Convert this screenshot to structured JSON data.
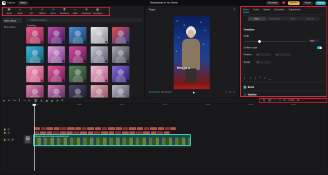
{
  "titlebar": {
    "app_name": "CapCut",
    "menu_label": "Menu",
    "project_title": "Mohammad in Ho Shrine",
    "shortcuts_label": "Shortcuts",
    "pro_label": "Join Pro",
    "share_label": "Share",
    "export_label": "Export"
  },
  "toolbar": {
    "tabs": [
      {
        "label": "Import",
        "icon": "import-icon"
      },
      {
        "label": "Audio",
        "icon": "audio-icon"
      },
      {
        "label": "Text",
        "icon": "text-icon"
      },
      {
        "label": "Stickers",
        "icon": "stickers-icon"
      },
      {
        "label": "Effects",
        "icon": "effects-icon"
      },
      {
        "label": "Transitions",
        "icon": "transitions-icon"
      },
      {
        "label": "Filters",
        "icon": "filters-icon"
      },
      {
        "label": "Adjustment",
        "icon": "adjustment-icon"
      },
      {
        "label": "Templates",
        "icon": "templates-icon"
      }
    ],
    "active_tab": "Effects"
  },
  "media_panel": {
    "nav": [
      "Video effects",
      "Body effects"
    ],
    "search_placeholder": "Search for effects",
    "section_title": "Trending"
  },
  "player": {
    "title": "Player",
    "caption": "this is a",
    "timecode_current": "00:00:00:00",
    "timecode_total": "00:00:32:27"
  },
  "inspector": {
    "tabs": [
      "Video",
      "Audio",
      "Speed",
      "Animation",
      "Adjustment"
    ],
    "active_tab": "Video",
    "sub_tabs": [
      "Basic",
      "Remove BG",
      "Mask",
      "Retouch"
    ],
    "active_sub_tab": "Basic",
    "transform_label": "Transform",
    "scale_label": "Scale",
    "scale_value": "100%",
    "uniform_scale_label": "Uniform scale",
    "position_label": "Position",
    "position_x": "0",
    "position_y": "0",
    "rotate_label": "Rotate",
    "rotate_value": "0°",
    "blend_label": "Blend",
    "stabilize_label": "Stabilize"
  },
  "timeline": {
    "ruler": [
      "00:00",
      "00:05",
      "00:10",
      "00:15",
      "00:20",
      "00:25",
      "00:30"
    ],
    "cover_label": "Cover",
    "clip_label": "Mohammad in Ho Shrine.mp4  00:00:32:27"
  },
  "colors": {
    "accent": "#1fd0de",
    "highlight_box": "#e0243a",
    "text_clip": "#b4524a",
    "video_clip": "#3ad6c7"
  }
}
